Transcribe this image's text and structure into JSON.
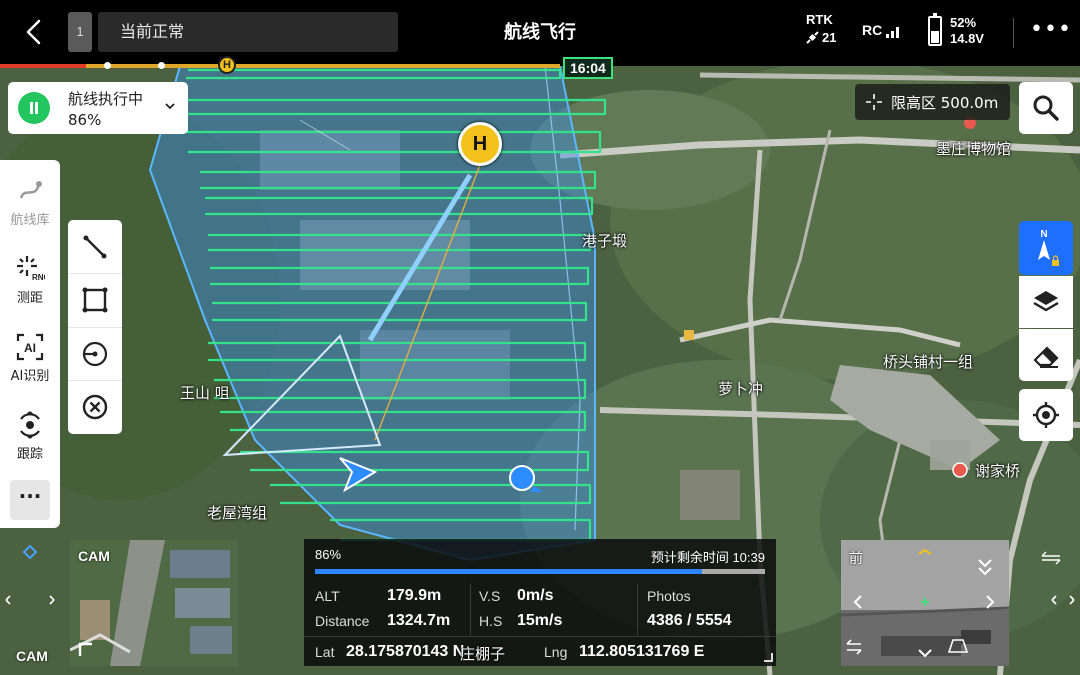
{
  "topbar": {
    "slot_number": "1",
    "status_text": "当前正常",
    "title": "航线飞行",
    "rtk_label": "RTK",
    "rtk_count": "21",
    "rc_label": "RC",
    "battery_percent": "52%",
    "battery_voltage": "14.8V",
    "battery_level": 0.52
  },
  "timeline": {
    "home_marker": "H",
    "time": "16:04"
  },
  "mission": {
    "status": "航线执行中",
    "progress": "86%"
  },
  "left_tools": [
    {
      "label": "航线库",
      "icon": "route-library-icon",
      "disabled": true
    },
    {
      "label": "测距",
      "icon": "rng-icon",
      "disabled": false
    },
    {
      "label": "AI识别",
      "icon": "ai-icon",
      "disabled": false
    },
    {
      "label": "跟踪",
      "icon": "track-icon",
      "disabled": false
    }
  ],
  "left_more": "···",
  "icons": {
    "rng_text": "RNG",
    "ai_text": "AI"
  },
  "limit": {
    "text": "限高区 500.0m"
  },
  "compass": {
    "north": "N"
  },
  "map_labels": [
    {
      "text": "墨庄博物馆"
    },
    {
      "text": "港子塅"
    },
    {
      "text": "桥头铺村一组"
    },
    {
      "text": "萝卜冲"
    },
    {
      "text": "王山 咀"
    },
    {
      "text": "谢家桥"
    },
    {
      "text": "老屋湾组"
    },
    {
      "text": "庄棚子"
    }
  ],
  "home_marker": "H",
  "telemetry": {
    "progress_text": "86%",
    "progress": 0.86,
    "remaining_label": "预计剩余时间",
    "remaining_time": "10:39",
    "alt_label": "ALT",
    "alt_value": "179.9m",
    "vs_label": "V.S",
    "vs_value": "0m/s",
    "photos_label": "Photos",
    "photos_value": "4386 / 5554",
    "dist_label": "Distance",
    "dist_value": "1324.7m",
    "hs_label": "H.S",
    "hs_value": "15m/s",
    "lat_label": "Lat",
    "lat_value": "28.175870143 N",
    "lng_label": "Lng",
    "lng_value": "112.805131769 E"
  },
  "cams": {
    "main_label": "CAM",
    "side_label": "CAM",
    "fpv_label": "前"
  },
  "colors": {
    "accent_green": "#3ee07a",
    "survey_blue": "#3aa0ff",
    "pause_green": "#22c55e",
    "home_yellow": "#f3c11b"
  }
}
